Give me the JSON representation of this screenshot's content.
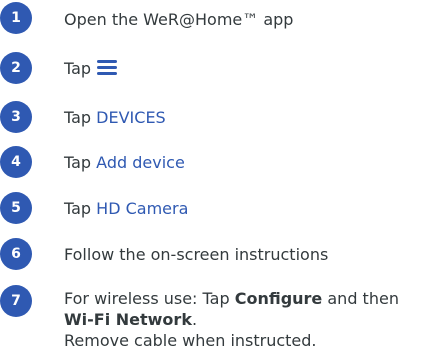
{
  "steps": [
    {
      "number": "1",
      "text": "Open the WeR@Home™ app"
    },
    {
      "number": "2",
      "prefix": "Tap",
      "icon": "hamburger-menu-icon"
    },
    {
      "number": "3",
      "prefix": "Tap ",
      "highlight": "DEVICES"
    },
    {
      "number": "4",
      "prefix": "Tap ",
      "highlight": "Add device"
    },
    {
      "number": "5",
      "prefix": "Tap ",
      "highlight": "HD Camera"
    },
    {
      "number": "6",
      "text": "Follow the on-screen instructions"
    },
    {
      "number": "7",
      "part1": "For wireless use: Tap ",
      "bold1": "Configure",
      "part2": " and then",
      "bold2": "Wi-Fi Network",
      "part3": ".",
      "line3": "Remove cable when instructed."
    }
  ],
  "colors": {
    "accent": "#2f59b2",
    "text": "#333a3d",
    "badge_text": "#ffffff"
  }
}
